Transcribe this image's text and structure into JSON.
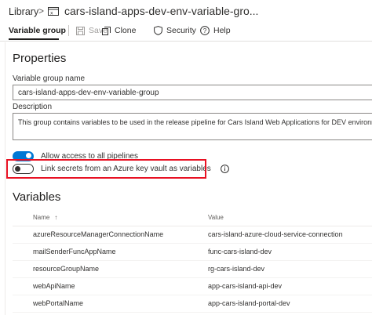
{
  "breadcrumb": {
    "library": "Library",
    "separator": ">",
    "title": "cars-island-apps-dev-env-variable-gro..."
  },
  "toolbar": {
    "tab_label": "Variable group",
    "save_label": "Save",
    "clone_label": "Clone",
    "security_label": "Security",
    "help_label": "Help"
  },
  "properties": {
    "heading": "Properties",
    "name_label": "Variable group name",
    "name_value": "cars-island-apps-dev-env-variable-group",
    "description_label": "Description",
    "description_value": "This group contains variables to be used in the release pipeline for Cars Island Web Applications for DEV environment.",
    "allow_access_label": "Allow access to all pipelines",
    "allow_access_on": true,
    "link_secrets_label": "Link secrets from an Azure key vault as variables",
    "link_secrets_on": false
  },
  "variables": {
    "heading": "Variables",
    "col_name": "Name",
    "col_sort_arrow": "↑",
    "col_value": "Value",
    "rows": [
      {
        "name": "azureResourceManagerConnectionName",
        "value": "cars-island-azure-cloud-service-connection"
      },
      {
        "name": "mailSenderFuncAppName",
        "value": "func-cars-island-dev"
      },
      {
        "name": "resourceGroupName",
        "value": "rg-cars-island-dev"
      },
      {
        "name": "webApiName",
        "value": "app-cars-island-api-dev"
      },
      {
        "name": "webPortalName",
        "value": "app-cars-island-portal-dev"
      }
    ]
  },
  "colors": {
    "accent": "#0078d4",
    "highlight": "#e81123"
  }
}
